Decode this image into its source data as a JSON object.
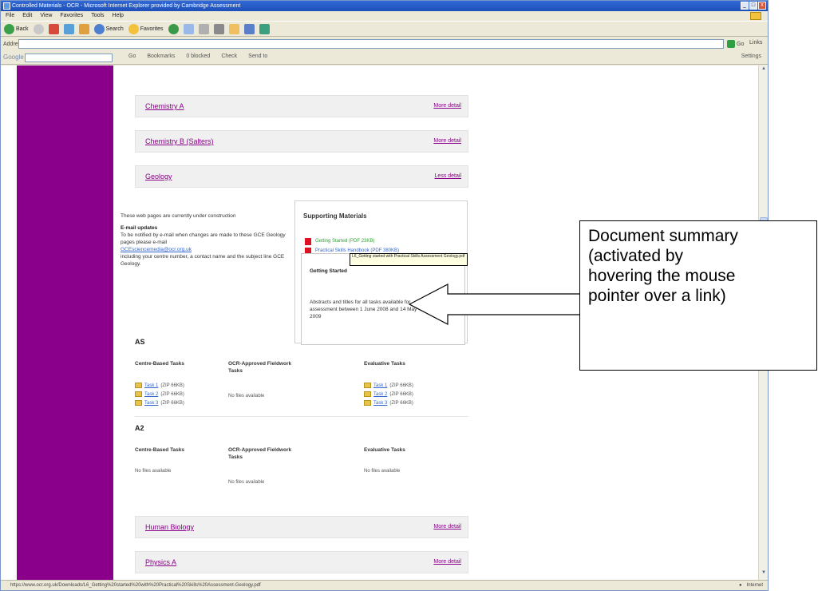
{
  "window": {
    "title": "Controlled Materials - OCR - Microsoft Internet Explorer provided by Cambridge Assessment",
    "controls": [
      "_",
      "□",
      "x"
    ]
  },
  "menubar": [
    "File",
    "Edit",
    "View",
    "Favorites",
    "Tools",
    "Help"
  ],
  "toolbar": {
    "back": "Back",
    "search": "Search",
    "favorites": "Favorites"
  },
  "address": {
    "label": "Address",
    "value": "",
    "go": "Go",
    "links": "Links"
  },
  "googlebar": {
    "logo": "Google",
    "items": [
      "Go",
      "Bookmarks",
      "0 blocked",
      "Check",
      "Send to"
    ],
    "settings": "Settings"
  },
  "content": {
    "accordions_top": [
      {
        "title": "Chemistry A",
        "more": "More detail"
      },
      {
        "title": "Chemistry B (Salters)",
        "more": "More detail"
      },
      {
        "title": "Geology",
        "more": "Less detail"
      }
    ],
    "notice": {
      "line1": "These web pages are currently under construction",
      "email_heading": "E-mail updates",
      "email_text": "To be notified by e-mail when changes are made to these GCE Geology pages please e-mail",
      "email_link": "GCEsciencemedia@ocr.org.uk",
      "email_tail": "including your centre number, a contact name and the subject line GCE Geology."
    },
    "supporting": {
      "heading": "Supporting Materials",
      "item1": "Getting Started (PDF 23KB)",
      "item2": "Practical Skills Handbook (PDF 380KB)",
      "tooltip": "L6_Getting started with Practical Skills Assessment Geology.pdf",
      "summary_heading": "Getting Started",
      "summary_text": "Abstracts and titles for all tasks available for assessment between 1 June 2008 and 14 May 2009"
    },
    "as": {
      "label": "AS",
      "columns": [
        "Centre-Based Tasks",
        "OCR-Approved Fieldwork Tasks",
        "Evaluative Tasks"
      ],
      "centre_tasks": [
        {
          "name": "Task 1",
          "size": "(ZIP 66KB)"
        },
        {
          "name": "Task 2",
          "size": "(ZIP 66KB)"
        },
        {
          "name": "Task 3",
          "size": "(ZIP 66KB)"
        }
      ],
      "fieldwork_text": "No files available",
      "evaluative_tasks": [
        {
          "name": "Task 1",
          "size": "(ZIP 66KB)"
        },
        {
          "name": "Task 2",
          "size": "(ZIP 66KB)"
        },
        {
          "name": "Task 3",
          "size": "(ZIP 66KB)"
        }
      ]
    },
    "a2": {
      "label": "A2",
      "columns": [
        "Centre-Based Tasks",
        "OCR-Approved Fieldwork Tasks",
        "Evaluative Tasks"
      ],
      "centre_text": "No files available",
      "fieldwork_text": "No files available",
      "evaluative_text": "No files available"
    },
    "accordions_bottom": [
      {
        "title": "Human Biology",
        "more": "More detail"
      },
      {
        "title": "Physics A",
        "more": "More detail"
      }
    ]
  },
  "statusbar": {
    "url": "https://www.ocr.org.uk/Downloads/L6_Getting%20started%20with%20Practical%20Skills%20Assessment-Geology.pdf",
    "zone": "Internet"
  },
  "callout": {
    "lines": [
      "Document summary",
      "(activated by",
      "hovering the mouse",
      "pointer over a link)"
    ]
  },
  "colors": {
    "brand_purple": "#8b008b",
    "link_blue": "#3366cc",
    "green_link": "#35a035"
  }
}
